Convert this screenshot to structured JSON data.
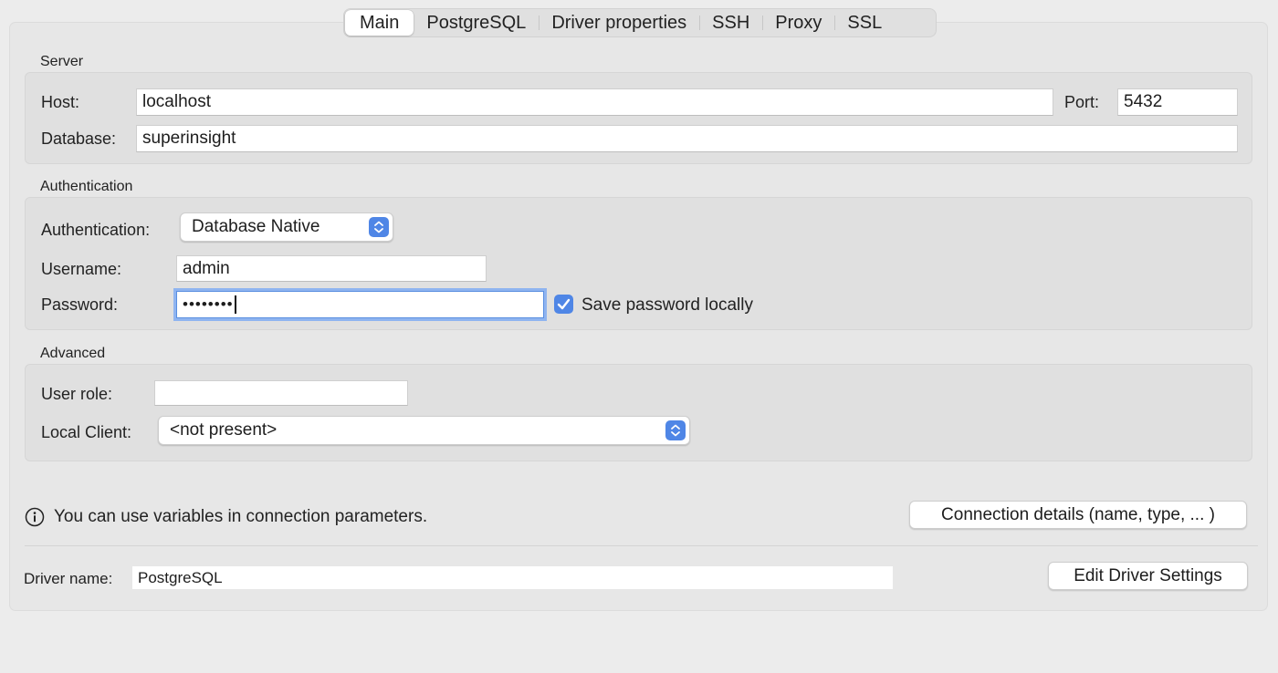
{
  "tabs": [
    {
      "label": "Main",
      "active": true
    },
    {
      "label": "PostgreSQL",
      "active": false
    },
    {
      "label": "Driver properties",
      "active": false
    },
    {
      "label": "SSH",
      "active": false
    },
    {
      "label": "Proxy",
      "active": false
    },
    {
      "label": "SSL",
      "active": false
    }
  ],
  "server": {
    "title": "Server",
    "host_label": "Host:",
    "host_value": "localhost",
    "port_label": "Port:",
    "port_value": "5432",
    "database_label": "Database:",
    "database_value": "superinsight"
  },
  "auth": {
    "title": "Authentication",
    "method_label": "Authentication:",
    "method_value": "Database Native",
    "username_label": "Username:",
    "username_value": "admin",
    "password_label": "Password:",
    "password_value": "••••••••",
    "save_password_label": "Save password locally",
    "save_password_checked": true
  },
  "advanced": {
    "title": "Advanced",
    "user_role_label": "User role:",
    "user_role_value": "",
    "local_client_label": "Local Client:",
    "local_client_value": "<not present>"
  },
  "footer": {
    "info_text": "You can use variables in connection parameters.",
    "connection_details_button": "Connection details (name, type, ... )",
    "driver_name_label": "Driver name:",
    "driver_name_value": "PostgreSQL",
    "edit_driver_button": "Edit Driver Settings"
  },
  "colors": {
    "accent": "#4f86e6",
    "focus_ring": "#8fb4f0"
  },
  "icons": {
    "stepper": "chevron-up-down-icon",
    "checkbox": "checkmark-icon",
    "info": "info-circle-icon"
  }
}
